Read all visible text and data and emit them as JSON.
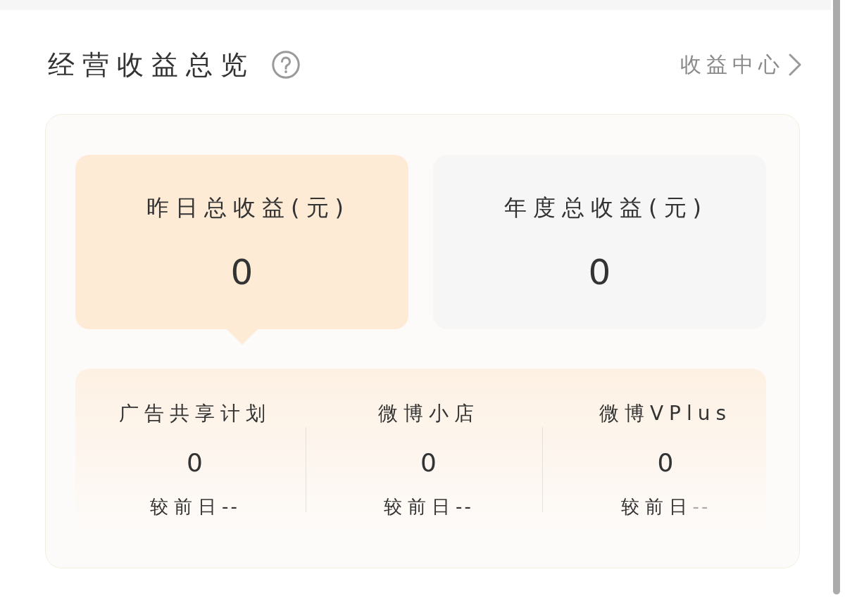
{
  "header": {
    "title": "经营收益总览",
    "link": "收益中心"
  },
  "summary_tiles": [
    {
      "label": "昨日总收益(元)",
      "value": "0",
      "selected": true
    },
    {
      "label": "年度总收益(元)",
      "value": "0",
      "selected": false
    }
  ],
  "breakdown": [
    {
      "name": "广告共享计划",
      "value": "0",
      "change_label": "较前日",
      "change": "--",
      "muted": false
    },
    {
      "name": "微博小店",
      "value": "0",
      "change_label": "较前日",
      "change": "--",
      "muted": false
    },
    {
      "name": "微博VPlus",
      "value": "0",
      "change_label": "较前日",
      "change": "--",
      "muted": true
    }
  ]
}
